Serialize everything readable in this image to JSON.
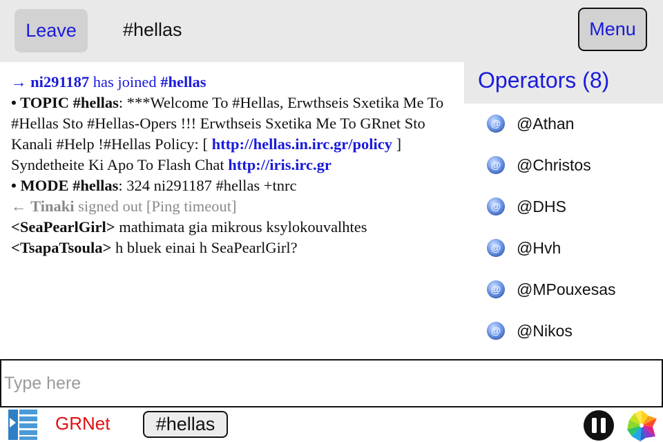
{
  "header": {
    "leave_label": "Leave",
    "channel": "#hellas",
    "menu_label": "Menu"
  },
  "chat": {
    "join": {
      "arrow": "→",
      "nick": "ni291187",
      "text": " has joined ",
      "channel": "#hellas"
    },
    "topic": {
      "bullet": "• ",
      "label": "TOPIC #hellas",
      "text1": ": ***Welcome To #Hellas, Erwthseis Sxetika Me To #Hellas Sto #Hellas-Opers !!! Erwthseis Sxetika Me To GRnet Sto Kanali #Help !#Hellas Policy: [ ",
      "link1": "http://hellas.in.irc.gr/policy",
      "text2": " ] Syndetheite Ki Apo To Flash Chat ",
      "link2": "http://iris.irc.gr"
    },
    "mode": {
      "bullet": "• ",
      "label": "MODE #hellas",
      "text": ": 324 ni291187 #hellas +tnrc"
    },
    "quit": {
      "arrow": "←",
      "nick": "Tinaki",
      "text": " signed out [Ping timeout]"
    },
    "messages": [
      {
        "nick": "<SeaPearlGirl>",
        "text": " mathimata gia mikrous ksylokouvalhtes"
      },
      {
        "nick": "<TsapaTsoula>",
        "text": " h bluek einai h SeaPearlGirl?"
      }
    ]
  },
  "operators": {
    "title": "Operators (8)",
    "items": [
      "@Athan",
      "@Christos",
      "@DHS",
      "@Hvh",
      "@MPouxesas",
      "@Nikos"
    ]
  },
  "input": {
    "placeholder": "Type here",
    "value": ""
  },
  "bottom_bar": {
    "server_name": "GRNet",
    "channel_tab": "#hellas",
    "server_name_color": "#e01010"
  },
  "icons": {
    "server": "server-list-icon",
    "operator": "operator-at-icon",
    "pause": "pause-icon",
    "app": "pinwheel-icon"
  },
  "colors": {
    "accent": "#1a1adb",
    "topbar": "#e9e9e9",
    "muted": "#8a8a8a"
  }
}
